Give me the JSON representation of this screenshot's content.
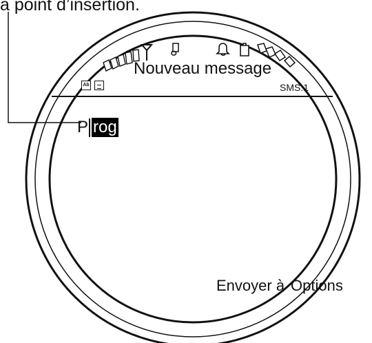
{
  "caption": {
    "text": "a point d’insertion."
  },
  "header": {
    "title": "Nouveau message",
    "sms_count": "SMS:1",
    "input_mode_label": "Ab"
  },
  "editor": {
    "before_cursor": "P",
    "selected_text": "rog"
  },
  "softkeys": {
    "left": "Envoyer à",
    "right": "Options"
  },
  "icons": {
    "signal": "signal-bars-icon",
    "antenna": "antenna-icon",
    "music": "music-note-icon",
    "alarm": "bell-icon",
    "battery": "battery-segments-icon",
    "input_mode": "input-mode-icon",
    "menu": "menu-icon"
  }
}
